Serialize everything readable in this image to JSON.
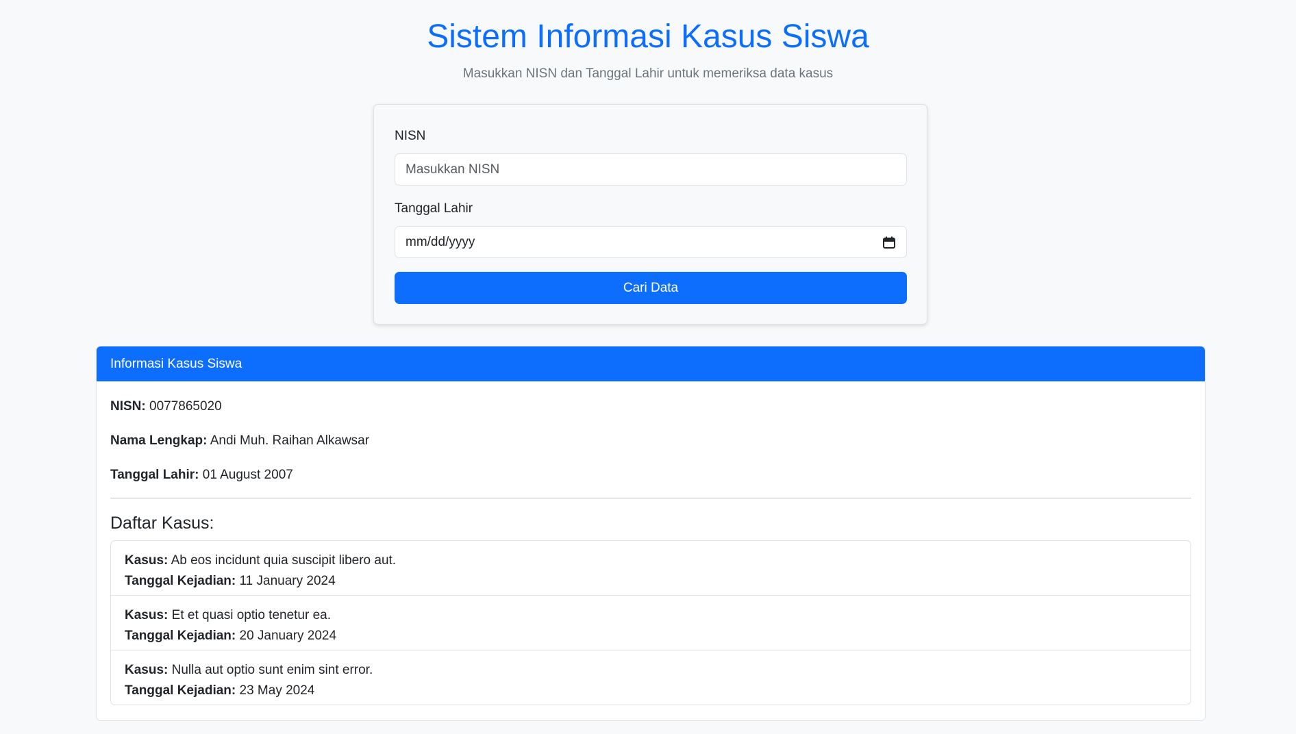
{
  "header": {
    "title": "Sistem Informasi Kasus Siswa",
    "subtitle": "Masukkan NISN dan Tanggal Lahir untuk memeriksa data kasus"
  },
  "form": {
    "nisn_label": "NISN",
    "nisn_placeholder": "Masukkan NISN",
    "nisn_value": "",
    "dob_label": "Tanggal Lahir",
    "dob_placeholder": "mm/dd/yyyy",
    "submit_label": "Cari Data"
  },
  "result": {
    "card_title": "Informasi Kasus Siswa",
    "nisn_label": "NISN:",
    "nisn_value": "0077865020",
    "name_label": "Nama Lengkap:",
    "name_value": "Andi Muh. Raihan Alkawsar",
    "dob_label": "Tanggal Lahir:",
    "dob_value": "01 August 2007",
    "cases_heading": "Daftar Kasus:",
    "case_label": "Kasus:",
    "date_label": "Tanggal Kejadian:",
    "cases": [
      {
        "description": "Ab eos incidunt quia suscipit libero aut.",
        "date": "11 January 2024"
      },
      {
        "description": "Et et quasi optio tenetur ea.",
        "date": "20 January 2024"
      },
      {
        "description": "Nulla aut optio sunt enim sint error.",
        "date": "23 May 2024"
      }
    ]
  },
  "colors": {
    "primary": "#0d6efd",
    "background": "#f8f9fa",
    "muted_text": "#6c757d"
  },
  "icons": {
    "date_picker": "calendar-icon"
  }
}
